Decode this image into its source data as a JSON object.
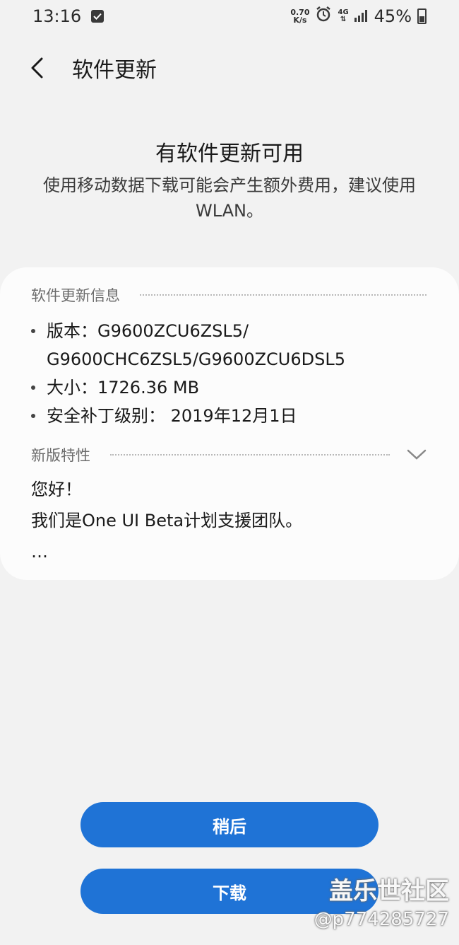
{
  "status_bar": {
    "time": "13:16",
    "net_speed_value": "0.70",
    "net_speed_unit": "K/s",
    "network_type": "4G",
    "battery_percent": "45%",
    "battery_level": 0.45,
    "icons": [
      "checkbox-icon",
      "alarm-icon",
      "signal-icon",
      "battery-icon"
    ]
  },
  "header": {
    "title": "软件更新"
  },
  "intro": {
    "title": "有软件更新可用",
    "description": "使用移动数据下载可能会产生额外费用，建议使用 WLAN。"
  },
  "update_info": {
    "section_label": "软件更新信息",
    "items": [
      "版本：G9600ZCU6ZSL5/ G9600CHC6ZSL5/G9600ZCU6DSL5",
      "大小：1726.36 MB",
      "安全补丁级别： 2019年12月1日"
    ]
  },
  "features": {
    "section_label": "新版特性",
    "lines": [
      "您好！",
      "我们是One UI Beta计划支援团队。",
      "…"
    ]
  },
  "actions": {
    "later_label": "稍后",
    "download_label": "下载"
  },
  "watermark": {
    "name": "盖乐世社区",
    "handle": "@p774285727"
  },
  "colors": {
    "accent": "#1f73d6",
    "background": "#f2f2f2",
    "card": "#fcfcfc"
  }
}
